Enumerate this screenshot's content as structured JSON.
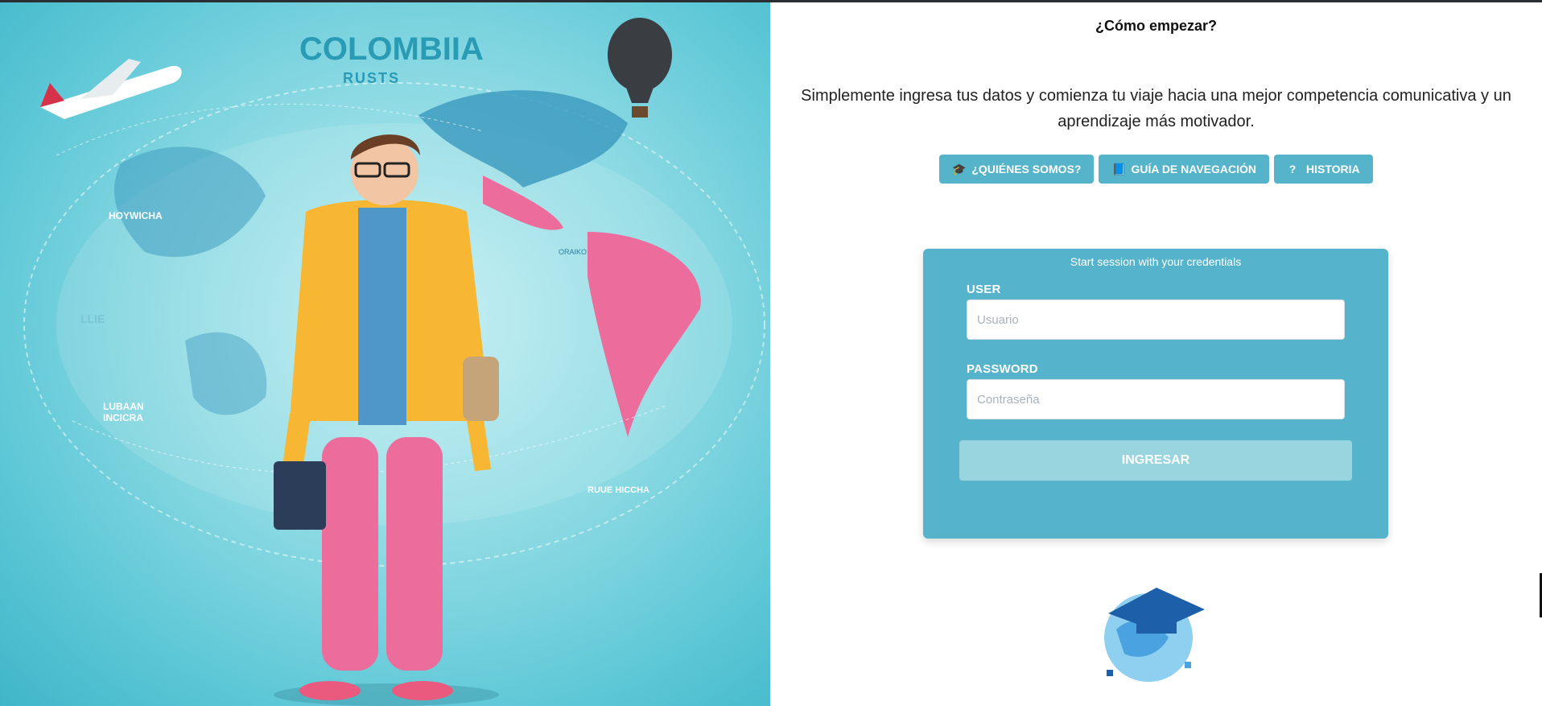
{
  "hero": {
    "brand_title": "COLOMBIIA",
    "brand_subtitle": "RUSTS",
    "map_labels": [
      "HOYWICHA",
      "LUBAAN INCICRA",
      "RUUE HICCHA",
      "ORAIKO",
      "LLIE"
    ]
  },
  "header": {
    "title": "¿Cómo empezar?"
  },
  "intro": {
    "text": "Simplemente ingresa tus datos y comienza tu viaje hacia una mejor competencia comunicativa y un aprendizaje más motivador."
  },
  "nav": [
    {
      "label": "¿QUIÉNES SOMOS?",
      "icon": "graduation-cap-icon"
    },
    {
      "label": "GUÍA DE NAVEGACIÓN",
      "icon": "book-icon"
    },
    {
      "label": "HISTORIA",
      "icon": "question-icon"
    }
  ],
  "login": {
    "title": "Start session with your credentials",
    "user_label": "USER",
    "user_placeholder": "Usuario",
    "user_value": "",
    "password_label": "PASSWORD",
    "password_placeholder": "Contraseña",
    "password_value": "",
    "submit_label": "INGRESAR"
  },
  "colors": {
    "accent": "#55b4c9",
    "card": "#55b4cb",
    "submit_disabled": "#98d5de",
    "pink": "#ec6d9c",
    "jacket": "#f7b733"
  }
}
